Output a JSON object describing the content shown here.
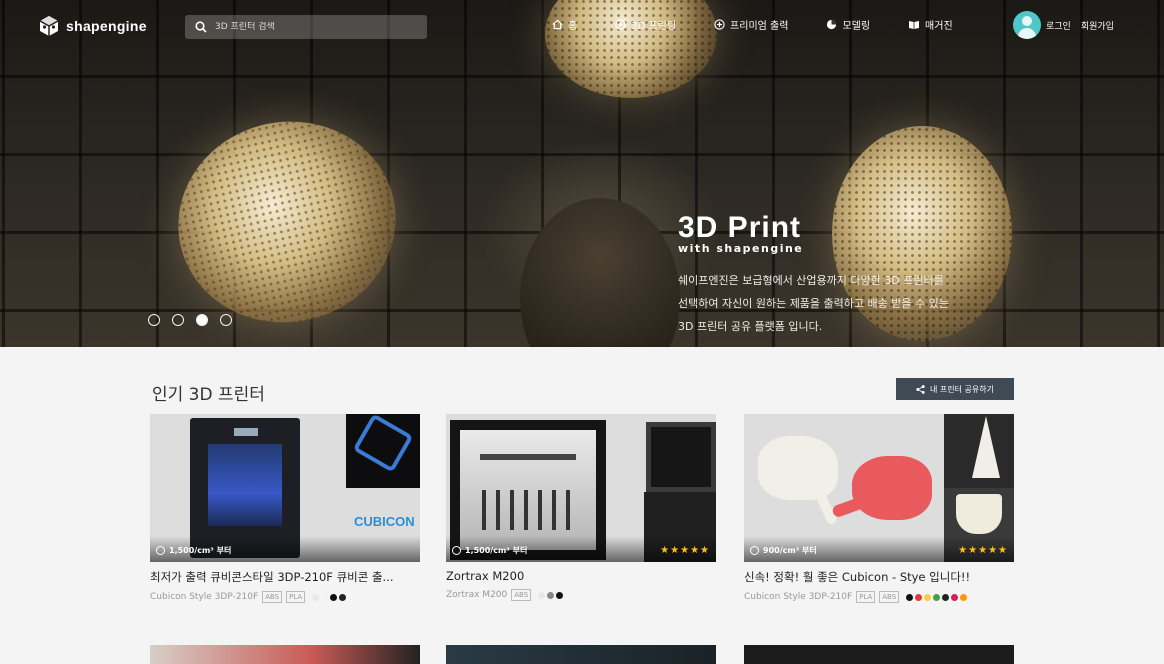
{
  "nav": {
    "logo_text": "shapengine",
    "search_placeholder": "3D 프린터 검색",
    "menu": [
      {
        "label": "홈",
        "icon": "home-icon"
      },
      {
        "label": "3D 프린팅",
        "icon": "play-circle-icon"
      },
      {
        "label": "프리미엄 출력",
        "icon": "plus-circle-icon"
      },
      {
        "label": "모델링",
        "icon": "pie-icon"
      },
      {
        "label": "매거진",
        "icon": "book-icon"
      }
    ],
    "login": "로그인",
    "signup": "회원가입"
  },
  "hero": {
    "title": "3D Print",
    "subtitle": "with shapengine",
    "desc_lines": [
      "쉐이프엔진은 보급형에서 산업용까지 다양한 3D 프린터를",
      "선택하여 자신이 원하는 제품을 출력하고 배송 받을 수 있는",
      "3D 프린터 공유 플랫폼 입니다."
    ],
    "slides": 4,
    "active_slide": 3
  },
  "section": {
    "title": "인기 3D 프린터",
    "share_button": "내 프린터 공유하기"
  },
  "cards": [
    {
      "price": "1,500/cm³ 부터",
      "stars": "",
      "title": "최저가 출력 큐비콘스타일 3DP-210F 큐비콘 출...",
      "model": "Cubicon Style 3DP-210F",
      "materials": [
        "ABS",
        "PLA"
      ],
      "colors": [
        "#e8e8e8",
        "#f2f2f2",
        "#111111",
        "#222222"
      ],
      "brand": "CUBICON"
    },
    {
      "price": "1,500/cm³ 부터",
      "stars": "★★★★★",
      "title": "Zortrax M200",
      "model": "Zortrax M200",
      "materials": [
        "ABS"
      ],
      "colors": [
        "#e8e8e8",
        "#888888",
        "#111111"
      ]
    },
    {
      "price": "900/cm³ 부터",
      "stars": "★★★★★",
      "title": "신속! 정확! 훨 좋은 Cubicon - Stye 입니다!!",
      "model": "Cubicon Style 3DP-210F",
      "materials": [
        "PLA",
        "ABS"
      ],
      "colors": [
        "#111111",
        "#e53935",
        "#f5d142",
        "#43a047",
        "#222222",
        "#d81b60",
        "#ff9800"
      ]
    }
  ]
}
